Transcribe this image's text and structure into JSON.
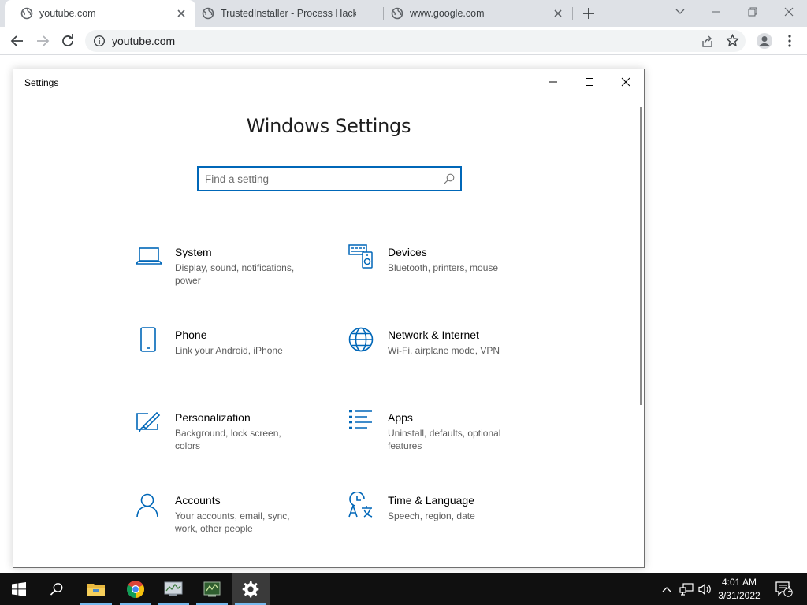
{
  "browser": {
    "tabs": [
      {
        "title": "youtube.com",
        "active": true
      },
      {
        "title": "TrustedInstaller - Process Hacker",
        "active": false
      },
      {
        "title": "www.google.com",
        "active": false
      }
    ],
    "address": "youtube.com"
  },
  "settings_window": {
    "title": "Settings",
    "heading": "Windows Settings",
    "search_placeholder": "Find a setting",
    "tiles": [
      {
        "name": "System",
        "desc": "Display, sound, notifications, power",
        "icon": "laptop-icon"
      },
      {
        "name": "Devices",
        "desc": "Bluetooth, printers, mouse",
        "icon": "devices-icon"
      },
      {
        "name": "Phone",
        "desc": "Link your Android, iPhone",
        "icon": "phone-icon"
      },
      {
        "name": "Network & Internet",
        "desc": "Wi-Fi, airplane mode, VPN",
        "icon": "globe-icon"
      },
      {
        "name": "Personalization",
        "desc": "Background, lock screen, colors",
        "icon": "brush-icon"
      },
      {
        "name": "Apps",
        "desc": "Uninstall, defaults, optional features",
        "icon": "apps-list-icon"
      },
      {
        "name": "Accounts",
        "desc": "Your accounts, email, sync, work, other people",
        "icon": "person-icon"
      },
      {
        "name": "Time & Language",
        "desc": "Speech, region, date",
        "icon": "time-language-icon"
      }
    ]
  },
  "taskbar": {
    "time": "4:01 AM",
    "date": "3/31/2022",
    "notification_count": "1"
  },
  "colors": {
    "accent": "#0067b8",
    "tab_strip": "#dee1e6",
    "taskbar": "#101010"
  }
}
